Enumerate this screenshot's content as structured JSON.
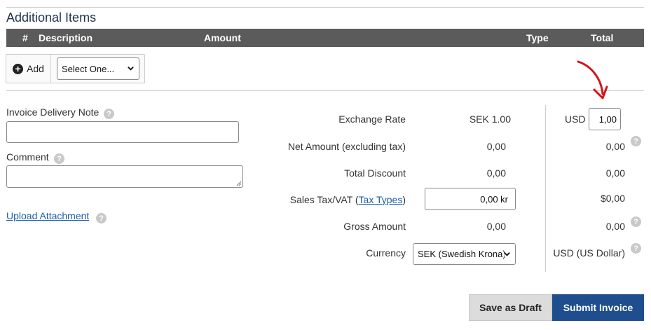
{
  "additional_items": {
    "title": "Additional Items",
    "columns": [
      "#",
      "Description",
      "Amount",
      "Type",
      "Total"
    ],
    "add_label": "Add",
    "select_value": "Select One..."
  },
  "left": {
    "delivery_note_label": "Invoice Delivery Note",
    "comment_label": "Comment",
    "upload_label": "Upload Attachment"
  },
  "summary": {
    "exchange_rate": {
      "label": "Exchange Rate",
      "value": "SEK 1.00",
      "currency": "USD",
      "input_value": "1,00"
    },
    "net_amount": {
      "label": "Net Amount (excluding tax)",
      "value": "0,00",
      "converted": "0,00"
    },
    "total_discount": {
      "label": "Total Discount",
      "value": "0,00",
      "converted": "0,00"
    },
    "sales_tax": {
      "label_prefix": "Sales Tax/VAT (",
      "link": "Tax Types",
      "label_suffix": ")",
      "input_value": "0,00 kr",
      "converted": "$0,00"
    },
    "gross_amount": {
      "label": "Gross Amount",
      "value": "0,00",
      "converted": "0,00"
    },
    "currency": {
      "label": "Currency",
      "select_value": "SEK (Swedish Krona)",
      "converted": "USD (US Dollar)"
    }
  },
  "help_icon_glyph": "?",
  "buttons": {
    "save_draft": "Save as Draft",
    "submit": "Submit Invoice"
  },
  "colors": {
    "header_bg": "#5b5b5b",
    "primary": "#1f4e8f",
    "arrow": "#d0161b",
    "link": "#1a5fa8"
  }
}
